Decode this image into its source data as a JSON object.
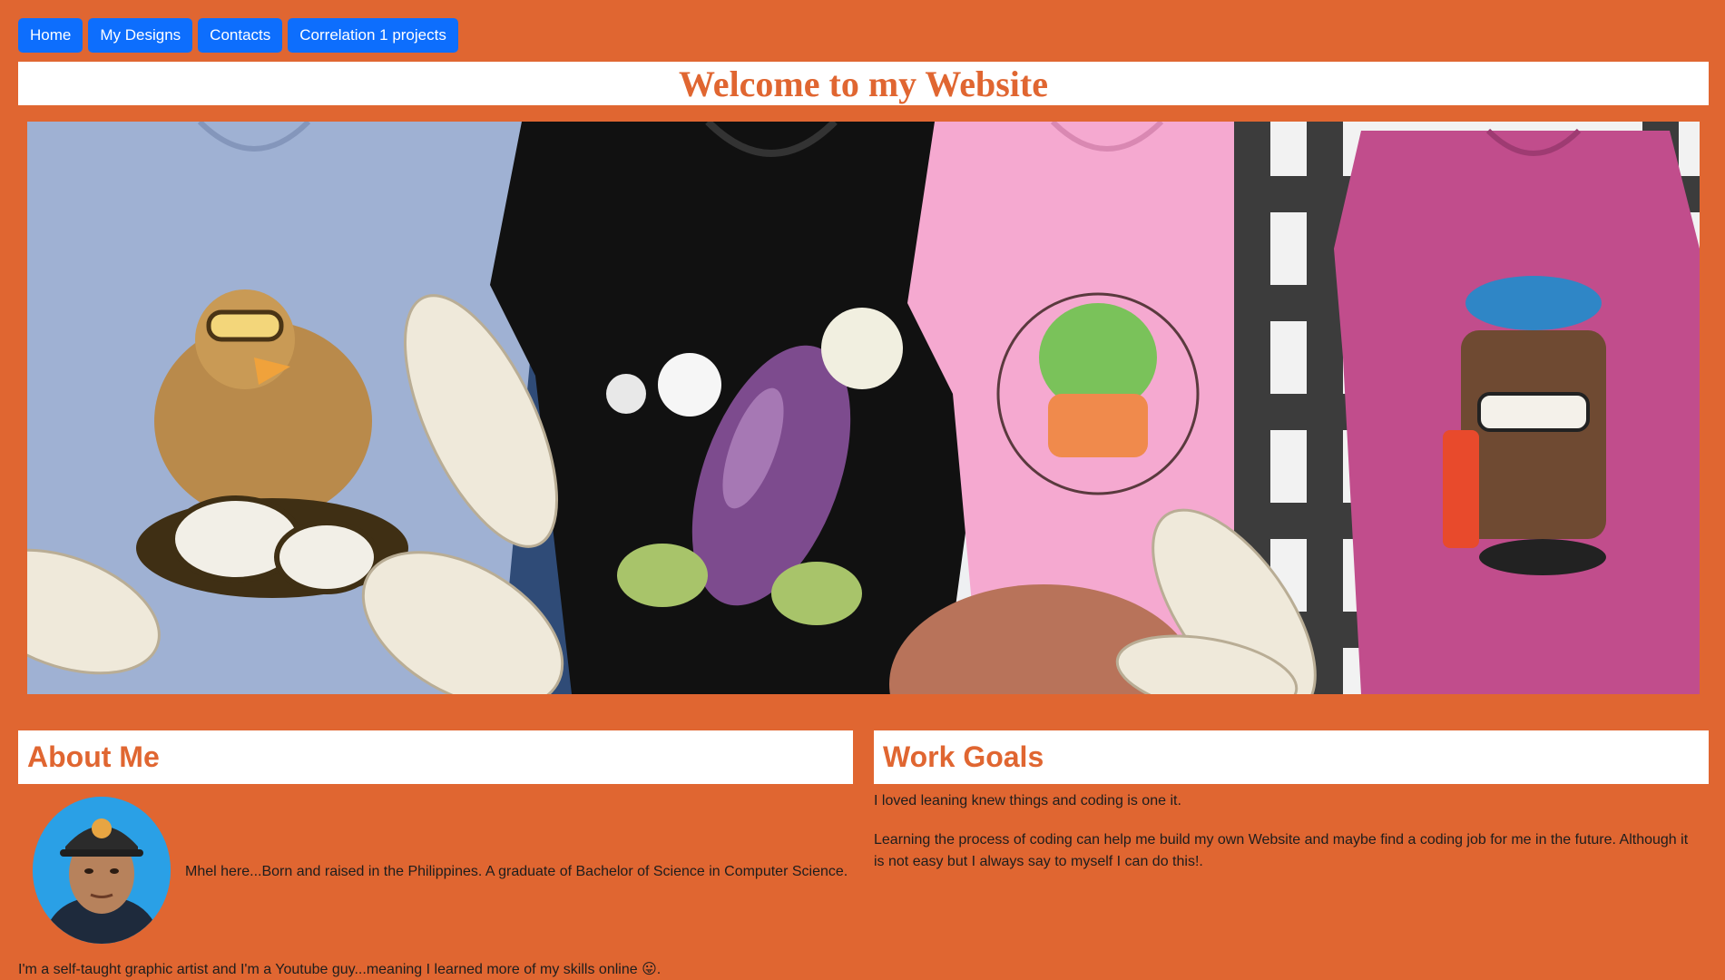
{
  "nav": {
    "items": [
      {
        "label": "Home"
      },
      {
        "label": "My Designs"
      },
      {
        "label": "Contacts"
      },
      {
        "label": "Correlation 1 projects"
      }
    ]
  },
  "header": {
    "title": "Welcome to my Website"
  },
  "hero": {
    "image": "tshirt-designs-banner"
  },
  "about": {
    "heading": "About Me",
    "intro": "Mhel here...Born and raised in the Philippines. A graduate of Bachelor of Science in Computer Science.",
    "more": "I'm a self-taught graphic artist and I'm a Youtube guy...meaning I learned more of my skills online 😛."
  },
  "goals": {
    "heading": "Work Goals",
    "p1": "I loved leaning knew things and coding is one it.",
    "p2": "Learning the process of coding can help me build my own Website and maybe find a coding job for me in the future. Although it is not easy but I always say to myself I can do this!."
  },
  "colors": {
    "background": "#e06631",
    "accent": "#e06631",
    "button": "#0d6efd"
  }
}
